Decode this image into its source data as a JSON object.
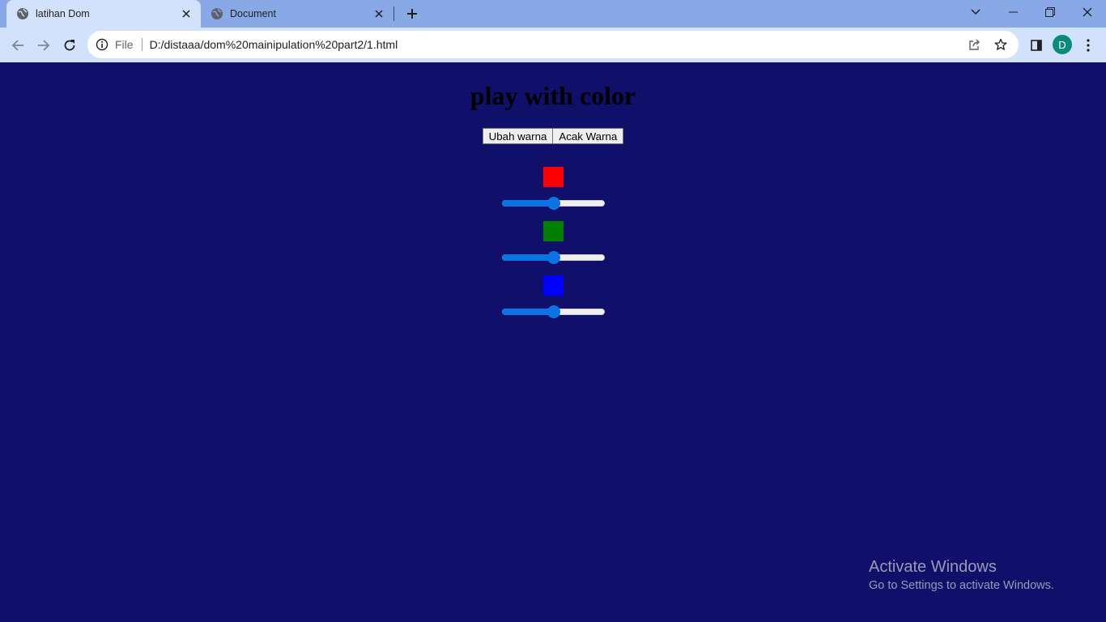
{
  "browser": {
    "tabs": [
      {
        "title": "latihan Dom",
        "active": true
      },
      {
        "title": "Document",
        "active": false
      }
    ],
    "address": {
      "scheme": "File",
      "url": "D:/distaaa/dom%20mainipulation%20part2/1.html"
    },
    "profile_initial": "D"
  },
  "page": {
    "title": "play with color",
    "buttons": {
      "change_color": "Ubah warna",
      "random_color": "Acak Warna"
    },
    "controls": [
      {
        "color": "#ff0000",
        "slider_value": 0.5
      },
      {
        "color": "#008000",
        "slider_value": 0.5
      },
      {
        "color": "#0000ff",
        "slider_value": 0.5
      }
    ],
    "background": "#10106a"
  },
  "watermark": {
    "line1": "Activate Windows",
    "line2": "Go to Settings to activate Windows."
  }
}
